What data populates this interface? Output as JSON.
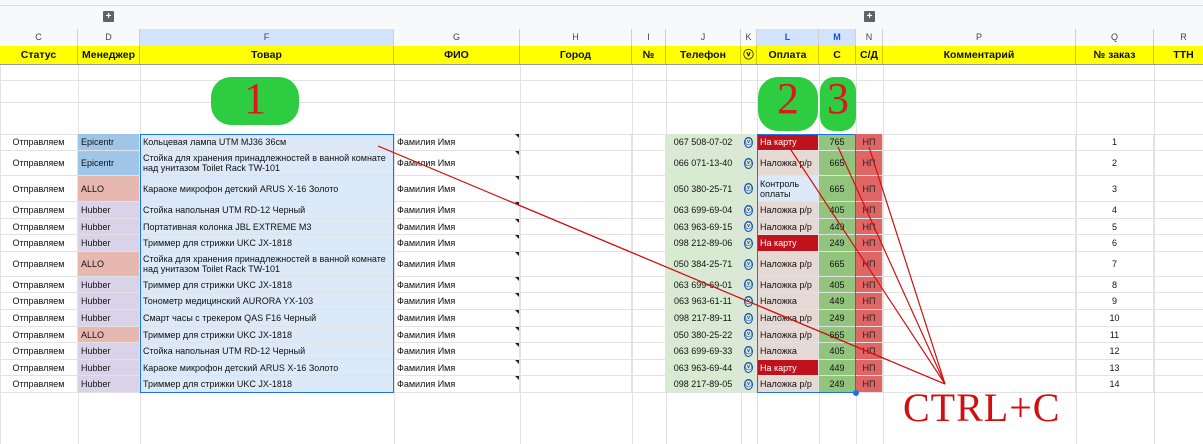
{
  "group_buttons": {
    "left": "+",
    "right": "+"
  },
  "columns": [
    "C",
    "D",
    "F",
    "G",
    "H",
    "I",
    "J",
    "K",
    "L",
    "M",
    "N",
    "P",
    "Q",
    "R"
  ],
  "selected_columns": [
    "L",
    "M"
  ],
  "headers": [
    "Статус",
    "Менеджер",
    "Товар",
    "ФИО",
    "Город",
    "№",
    "Телефон",
    "ⓥ",
    "Оплата",
    "С",
    "С/Д",
    "Комментарий",
    "№ заказ",
    "ТТН"
  ],
  "badges": [
    "1",
    "2",
    "3"
  ],
  "overlay_text": "CTRL+C",
  "rows": [
    {
      "status": "Отправляем",
      "manager": "Epicentr",
      "product": "Кольцевая лампа UTM MJ36 36см",
      "fio": "Фамилия Имя",
      "phone": "067 508-07-02",
      "k": "ⓥ",
      "payment": "На карту",
      "sum": "765",
      "sd": "НП",
      "order": "1"
    },
    {
      "status": "Отправляем",
      "manager": "Epicentr",
      "product": "Стойка для хранения принадлежностей в ванной комнате над унитазом Toilet Rack TW-101",
      "fio": "Фамилия Имя",
      "phone": "066 071-13-40",
      "k": "ⓥ",
      "payment": "Наложка р/р",
      "sum": "665",
      "sd": "НП",
      "order": "2"
    },
    {
      "status": "Отправляем",
      "manager": "ALLO",
      "product": "Караоке микрофон детский ARUS X-16 Золото",
      "fio": "Фамилия Имя",
      "phone": "050 380-25-71",
      "k": "ⓥ",
      "payment": "Контроль оплаты",
      "sum": "665",
      "sd": "НП",
      "order": "3"
    },
    {
      "status": "Отправляем",
      "manager": "Hubber",
      "product": "Стойка напольная UTM RD-12 Черный",
      "fio": "Фамилия Имя",
      "phone": "063 699-69-04",
      "k": "ⓥ",
      "payment": "Наложка р/р",
      "sum": "405",
      "sd": "НП",
      "order": "4"
    },
    {
      "status": "Отправляем",
      "manager": "Hubber",
      "product": "Портативная колонка JBL EXTREME M3",
      "fio": "Фамилия Имя",
      "phone": "063 963-69-15",
      "k": "ⓥ",
      "payment": "Наложка р/р",
      "sum": "449",
      "sd": "НП",
      "order": "5"
    },
    {
      "status": "Отправляем",
      "manager": "Hubber",
      "product": "Триммер для стрижки UKC JX-1818",
      "fio": "Фамилия Имя",
      "phone": "098 212-89-06",
      "k": "ⓥ",
      "payment": "На карту",
      "sum": "249",
      "sd": "НП",
      "order": "6"
    },
    {
      "status": "Отправляем",
      "manager": "ALLO",
      "product": "Стойка для хранения принадлежностей в ванной комнате над унитазом Toilet Rack TW-101",
      "fio": "Фамилия Имя",
      "phone": "050 384-25-71",
      "k": "ⓥ",
      "payment": "Наложка р/р",
      "sum": "665",
      "sd": "НП",
      "order": "7"
    },
    {
      "status": "Отправляем",
      "manager": "Hubber",
      "product": "Триммер для стрижки UKC JX-1818",
      "fio": "Фамилия Имя",
      "phone": "063 699-69-01",
      "k": "ⓥ",
      "payment": "Наложка р/р",
      "sum": "405",
      "sd": "НП",
      "order": "8"
    },
    {
      "status": "Отправляем",
      "manager": "Hubber",
      "product": "Тонометр медицинский AURORA YX-103",
      "fio": "Фамилия Имя",
      "phone": "063 963-61-11",
      "k": "ⓥ",
      "payment": "Наложка",
      "sum": "449",
      "sd": "НП",
      "order": "9"
    },
    {
      "status": "Отправляем",
      "manager": "Hubber",
      "product": "Смарт часы с трекером QAS F16 Черный",
      "fio": "Фамилия Имя",
      "phone": "098 217-89-11",
      "k": "ⓥ",
      "payment": "Наложка р/р",
      "sum": "249",
      "sd": "НП",
      "order": "10"
    },
    {
      "status": "Отправляем",
      "manager": "ALLO",
      "product": "Триммер для стрижки UKC JX-1818",
      "fio": "Фамилия Имя",
      "phone": "050 380-25-22",
      "k": "ⓥ",
      "payment": "Наложка р/р",
      "sum": "665",
      "sd": "НП",
      "order": "11"
    },
    {
      "status": "Отправляем",
      "manager": "Hubber",
      "product": "Стойка напольная UTM RD-12 Черный",
      "fio": "Фамилия Имя",
      "phone": "063 699-69-33",
      "k": "ⓥ",
      "payment": "Наложка",
      "sum": "405",
      "sd": "НП",
      "order": "12"
    },
    {
      "status": "Отправляем",
      "manager": "Hubber",
      "product": "Караоке микрофон детский ARUS X-16 Золото",
      "fio": "Фамилия Имя",
      "phone": "063 963-69-44",
      "k": "ⓥ",
      "payment": "На карту",
      "sum": "449",
      "sd": "НП",
      "order": "13"
    },
    {
      "status": "Отправляем",
      "manager": "Hubber",
      "product": "Триммер для стрижки UKC JX-1818",
      "fio": "Фамилия Имя",
      "phone": "098 217-89-05",
      "k": "ⓥ",
      "payment": "Наложка р/р",
      "sum": "249",
      "sd": "НП",
      "order": "14"
    }
  ]
}
